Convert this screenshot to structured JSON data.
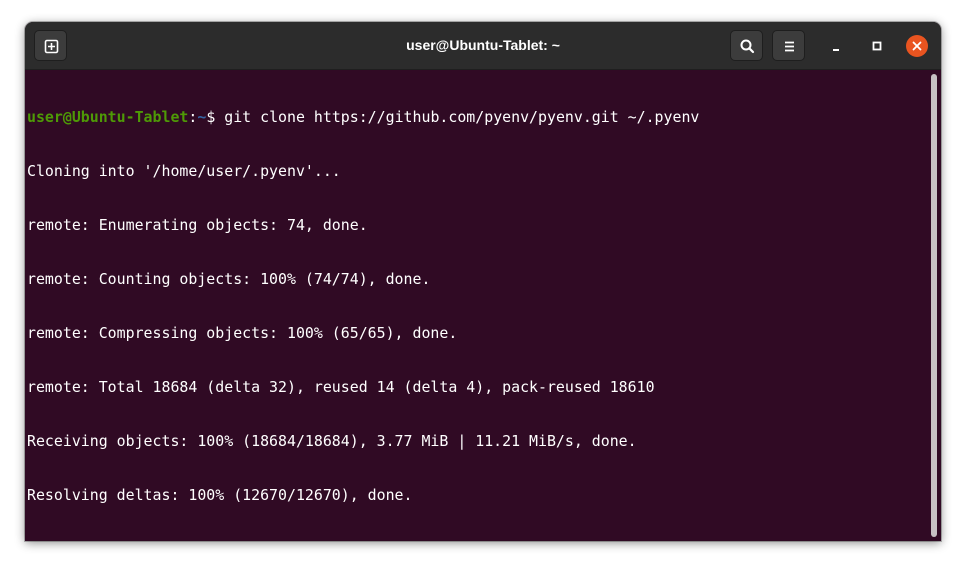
{
  "window": {
    "title": "user@Ubuntu-Tablet: ~"
  },
  "header": {
    "new_tab_icon": "new-tab-icon",
    "search_icon": "search-icon",
    "menu_icon": "hamburger-menu-icon",
    "minimize_icon": "minimize-icon",
    "maximize_icon": "maximize-icon",
    "close_icon": "close-icon"
  },
  "colors": {
    "terminal_bg": "#300a24",
    "prompt_user": "#4e9a06",
    "prompt_path": "#3465a4",
    "close_button": "#e95420",
    "titlebar_bg": "#2c2c2c"
  },
  "terminal": {
    "prompt": {
      "user_host": "user@Ubuntu-Tablet",
      "colon": ":",
      "path": "~",
      "symbol": "$"
    },
    "command": " git clone https://github.com/pyenv/pyenv.git ~/.pyenv",
    "output": [
      "Cloning into '/home/user/.pyenv'...",
      "remote: Enumerating objects: 74, done.",
      "remote: Counting objects: 100% (74/74), done.",
      "remote: Compressing objects: 100% (65/65), done.",
      "remote: Total 18684 (delta 32), reused 14 (delta 4), pack-reused 18610",
      "Receiving objects: 100% (18684/18684), 3.77 MiB | 11.21 MiB/s, done.",
      "Resolving deltas: 100% (12670/12670), done."
    ]
  }
}
